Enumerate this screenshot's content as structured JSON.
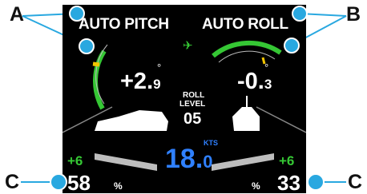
{
  "callouts": {
    "a": "A",
    "b": "B",
    "c_left": "C",
    "c_right": "C"
  },
  "pitch": {
    "title": "AUTO PITCH",
    "value_int": "+2.",
    "value_frac": "9",
    "degree": "°"
  },
  "roll": {
    "title": "AUTO ROLL",
    "value_int": "-0.",
    "value_frac": "3",
    "degree": "°"
  },
  "roll_level": {
    "line1": "ROLL",
    "line2": "LEVEL",
    "value": "05"
  },
  "speed": {
    "value_int": "18.",
    "value_frac": "0",
    "unit": "KTS"
  },
  "left_tab": {
    "delta": "+6",
    "percent": "58",
    "percent_sign": "%"
  },
  "right_tab": {
    "delta": "+6",
    "percent": "33",
    "percent_sign": "%"
  },
  "gps_icon": "satellite-icon",
  "colors": {
    "accent_green": "#35c734",
    "accent_blue": "#2f80ff",
    "indicator_yellow": "#f2c500",
    "callout_blue": "#29a8e0"
  }
}
